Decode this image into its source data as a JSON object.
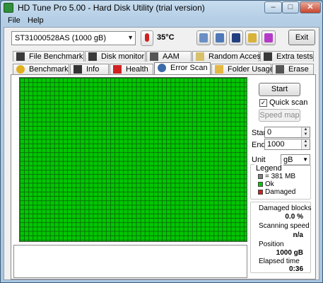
{
  "window": {
    "title": "HD Tune Pro 5.00 - Hard Disk Utility (trial version)"
  },
  "menu": [
    {
      "label": "File"
    },
    {
      "label": "Help"
    }
  ],
  "toolbar": {
    "drive": "ST31000528AS (1000 gB)",
    "temperature": "35°C",
    "exit_label": "Exit"
  },
  "tabs_top": [
    {
      "label": "File Benchmark",
      "icon": "file-benchmark-icon"
    },
    {
      "label": "Disk monitor",
      "icon": "disk-monitor-icon"
    },
    {
      "label": "AAM",
      "icon": "speaker-icon"
    },
    {
      "label": "Random Access",
      "icon": "random-access-icon"
    },
    {
      "label": "Extra tests",
      "icon": "extra-tests-icon"
    }
  ],
  "tabs_bottom": [
    {
      "label": "Benchmark",
      "icon": "benchmark-icon"
    },
    {
      "label": "Info",
      "icon": "info-icon"
    },
    {
      "label": "Health",
      "icon": "health-cross-icon"
    },
    {
      "label": "Error Scan",
      "icon": "magnifier-icon",
      "active": true
    },
    {
      "label": "Folder Usage",
      "icon": "folder-icon"
    },
    {
      "label": "Erase",
      "icon": "trash-icon"
    }
  ],
  "controls": {
    "start_label": "Start",
    "quick_scan_label": "Quick scan",
    "quick_scan_checked": true,
    "speed_map_label": "Speed map",
    "start_field_label": "Start",
    "start_value": "0",
    "end_field_label": "End",
    "end_value": "1000",
    "unit_label": "Unit",
    "unit_value": "gB"
  },
  "legend": {
    "title": "Legend",
    "items": [
      {
        "label": "= 381 MB",
        "color": "#808080"
      },
      {
        "label": "Ok",
        "color": "#00c800"
      },
      {
        "label": "Damaged",
        "color": "#d02020"
      }
    ]
  },
  "stats": {
    "damaged_label": "Damaged blocks",
    "damaged_value": "0.0 %",
    "speed_label": "Scanning speed",
    "speed_value": "n/a",
    "position_label": "Position",
    "position_value": "1000 gB",
    "elapsed_label": "Elapsed time",
    "elapsed_value": "0:36"
  },
  "scan_grid": {
    "state": "all blocks ok",
    "color": "#00c800"
  }
}
